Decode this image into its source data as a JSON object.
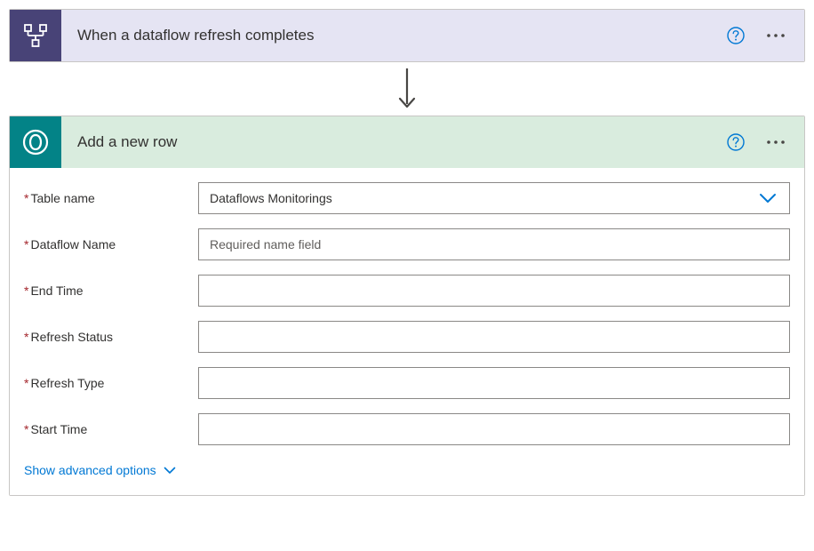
{
  "trigger": {
    "title": "When a dataflow refresh completes"
  },
  "action": {
    "title": "Add a new row",
    "fields": {
      "table_name": {
        "label": "Table name",
        "value": "Dataflows Monitorings"
      },
      "dataflow_name": {
        "label": "Dataflow Name",
        "placeholder": "Required name field",
        "value": ""
      },
      "end_time": {
        "label": "End Time",
        "value": ""
      },
      "refresh_status": {
        "label": "Refresh Status",
        "value": ""
      },
      "refresh_type": {
        "label": "Refresh Type",
        "value": ""
      },
      "start_time": {
        "label": "Start Time",
        "value": ""
      }
    },
    "advanced_link": "Show advanced options"
  }
}
